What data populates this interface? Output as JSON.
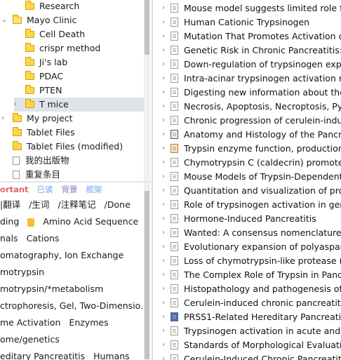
{
  "left_tree": [
    {
      "label": "Research",
      "indent": 1,
      "chevron": "",
      "icon": "folder",
      "selected": false
    },
    {
      "label": "Mayo Clinic",
      "indent": 0,
      "chevron": "⌄",
      "icon": "folder-open",
      "selected": false
    },
    {
      "label": "Cell Death",
      "indent": 1,
      "chevron": "",
      "icon": "folder",
      "selected": false
    },
    {
      "label": "crispr method",
      "indent": 1,
      "chevron": "",
      "icon": "folder",
      "selected": false
    },
    {
      "label": "Ji's lab",
      "indent": 1,
      "chevron": "",
      "icon": "folder",
      "selected": false
    },
    {
      "label": "PDAC",
      "indent": 1,
      "chevron": "",
      "icon": "folder",
      "selected": false
    },
    {
      "label": "PTEN",
      "indent": 1,
      "chevron": "",
      "icon": "folder",
      "selected": false
    },
    {
      "label": "T mice",
      "indent": 1,
      "chevron": "›",
      "icon": "folder",
      "selected": true
    },
    {
      "label": "My project",
      "indent": 0,
      "chevron": "›",
      "icon": "folder",
      "selected": false
    },
    {
      "label": "Tablet Files",
      "indent": 0,
      "chevron": "",
      "icon": "folder",
      "selected": false
    },
    {
      "label": "Tablet Files (modified)",
      "indent": 0,
      "chevron": "",
      "icon": "folder",
      "selected": false
    },
    {
      "label": "我的出版物",
      "indent": 0,
      "chevron": "",
      "icon": "doc",
      "selected": false
    },
    {
      "label": "重复条目",
      "indent": 0,
      "chevron": "",
      "icon": "doc",
      "selected": false
    }
  ],
  "tag_toolbar": [
    {
      "label": "ortant",
      "color": "#e06666"
    },
    {
      "label": "已读",
      "color": "#9fc5e8"
    },
    {
      "label": "背景",
      "color": "#b4a7d6"
    },
    {
      "label": "框架",
      "color": "#a4c2f4"
    }
  ],
  "tags": [
    {
      "parts": [
        "|翻译",
        "/生词",
        "/注释笔记",
        "/Done"
      ],
      "icon": false
    },
    {
      "parts": [
        "ding",
        "Amino Acid Sequence"
      ],
      "icon": true
    },
    {
      "parts": [
        "nals",
        "Cations"
      ],
      "icon": false
    },
    {
      "parts": [
        "omatography, Ion Exchange"
      ],
      "icon": false
    },
    {
      "parts": [
        "motrypsin"
      ],
      "icon": false
    },
    {
      "parts": [
        "motrypsin/*metabolism"
      ],
      "icon": false
    },
    {
      "parts": [
        "ctrophoresis, Gel, Two-Dimensio..."
      ],
      "icon": false
    },
    {
      "parts": [
        "me Activation",
        "Enzymes"
      ],
      "icon": false
    },
    {
      "parts": [
        "ome/genetics"
      ],
      "icon": false
    },
    {
      "parts": [
        "editary Pancreatitis",
        "Humans"
      ],
      "icon": false
    }
  ],
  "items": [
    {
      "title": "Mouse model suggests limited role for",
      "icon": "doc"
    },
    {
      "title": "Human Cationic Trypsinogen",
      "icon": "doc"
    },
    {
      "title": "Mutation That Promotes Activation of T",
      "icon": "doc"
    },
    {
      "title": "Genetic Risk in Chronic Pancreatitis: The",
      "icon": "doc"
    },
    {
      "title": "Down-regulation of trypsinogen expres",
      "icon": "doc"
    },
    {
      "title": "Intra-acinar trypsinogen activation mec",
      "icon": "doc"
    },
    {
      "title": "Digesting new information about the ro",
      "icon": "doc"
    },
    {
      "title": "Necrosis, Apoptosis, Necroptosis, Pyrop",
      "icon": "doc"
    },
    {
      "title": "Chronic progression of cerulein-induce",
      "icon": "doc"
    },
    {
      "title": "Anatomy and Histology of the Pancreas",
      "icon": "book"
    },
    {
      "title": "Trypsin enzyme function, production, cl",
      "icon": "tan"
    },
    {
      "title": "Chymotrypsin C (caldecrin) promotes d",
      "icon": "doc"
    },
    {
      "title": "Mouse Models of Trypsin-Dependent P",
      "icon": "doc"
    },
    {
      "title": "Quantitation and visualization of protea",
      "icon": "doc"
    },
    {
      "title": "Role of trypsinogen activation in genes",
      "icon": "doc"
    },
    {
      "title": "Hormone-Induced Pancreatitis",
      "icon": "doc"
    },
    {
      "title": "Wanted: A consensus nomenclature for",
      "icon": "doc"
    },
    {
      "title": "Evolutionary expansion of polyaspartate",
      "icon": "doc"
    },
    {
      "title": "Loss of chymotrypsin-like protease (CTI",
      "icon": "doc"
    },
    {
      "title": "The Complex Role of Trypsin in Pancrea",
      "icon": "doc"
    },
    {
      "title": "Histopathology and pathogenesis of ca",
      "icon": "doc"
    },
    {
      "title": "Cerulein-induced chronic pancreatitis d",
      "icon": "doc"
    },
    {
      "title": "PRSS1-Related Hereditary Pancreatitis",
      "icon": "book2"
    },
    {
      "title": "Trypsinogen activation in acute and chr",
      "icon": "doc"
    },
    {
      "title": "Standards of Morphological Evaluation",
      "icon": "doc"
    },
    {
      "title": "Cerulein-Induced Chronic Pancreatitis D",
      "icon": "doc"
    }
  ],
  "item_chevron": "›"
}
